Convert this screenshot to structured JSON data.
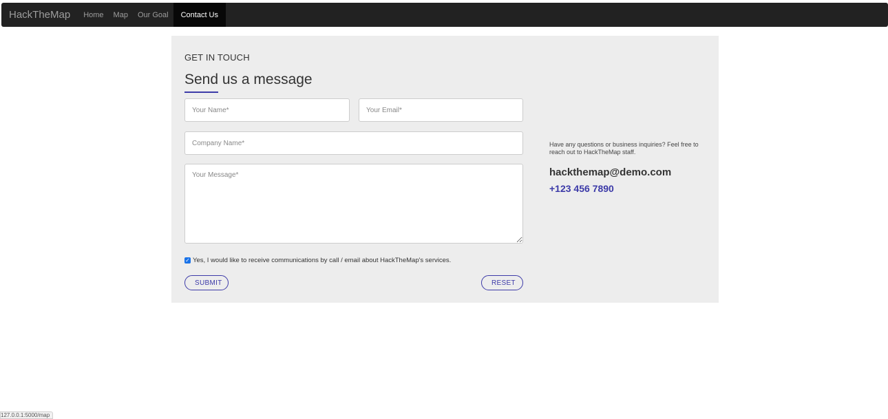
{
  "navbar": {
    "brand": "HackTheMap",
    "items": [
      {
        "label": "Home"
      },
      {
        "label": "Map"
      },
      {
        "label": "Our Goal"
      },
      {
        "label": "Contact Us"
      }
    ],
    "active": "Contact Us"
  },
  "contact": {
    "eyebrow": "GET IN TOUCH",
    "heading": "Send us a message",
    "fields": {
      "name_placeholder": "Your Name*",
      "email_placeholder": "Your Email*",
      "company_placeholder": "Company Name*",
      "message_placeholder": "Your Message*"
    },
    "consent_label": "Yes, I would like to receive communications by call / email about HackTheMap's services.",
    "consent_checked": true,
    "submit_label": "SUBMIT",
    "reset_label": "RESET"
  },
  "info": {
    "text": "Have any questions or business inquiries? Feel free to reach out to HackTheMap staff.",
    "email": "hackthemap@demo.com",
    "phone": "+123 456 7890"
  },
  "status_bar": {
    "url": "127.0.0.1:5000/map"
  },
  "colors": {
    "accent": "#3c3aa8",
    "navbar_bg": "#222222",
    "card_bg": "#ededed"
  }
}
